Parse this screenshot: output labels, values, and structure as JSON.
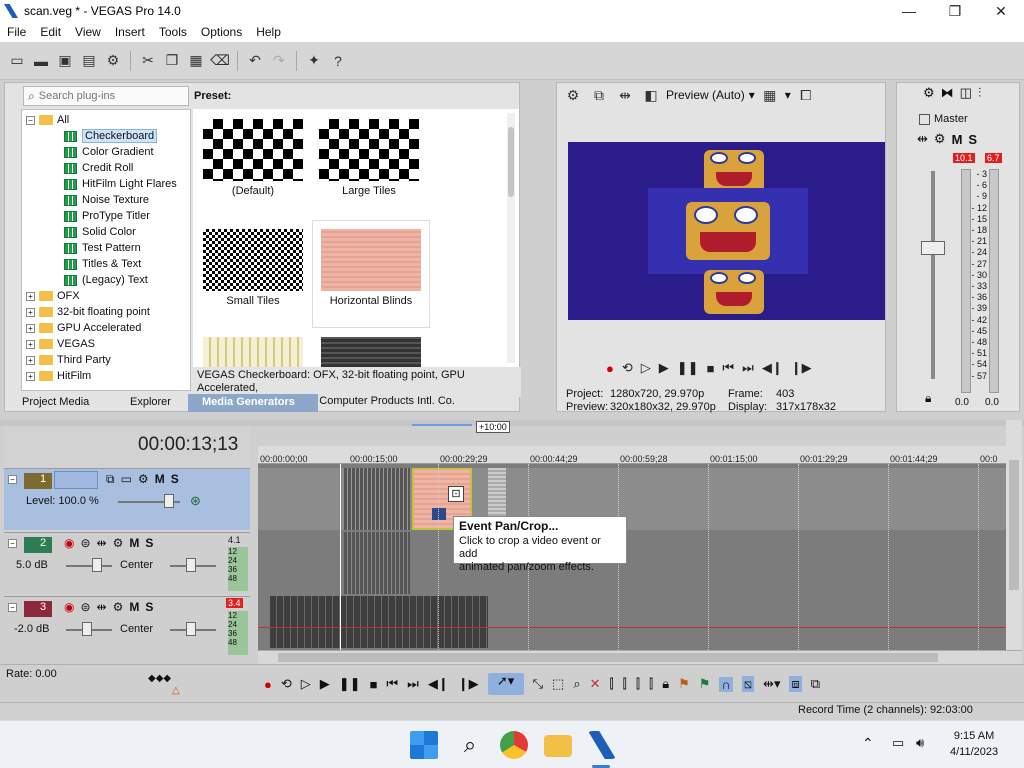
{
  "window": {
    "title": "scan.veg * - VEGAS Pro 14.0",
    "controls": [
      "—",
      "❐",
      "✕"
    ]
  },
  "menu": [
    "File",
    "Edit",
    "View",
    "Insert",
    "Tools",
    "Options",
    "Help"
  ],
  "toolbar_icons": [
    "new-icon",
    "open-icon",
    "save-icon",
    "save-as-icon",
    "properties-icon",
    "cut-icon",
    "copy-icon",
    "paste-icon",
    "delete-icon",
    "undo-icon",
    "redo-icon",
    "render-icon",
    "whats-this-icon"
  ],
  "plugins": {
    "search_placeholder": "Search plug-ins",
    "tree": {
      "root": "All",
      "children": [
        "Checkerboard",
        "Color Gradient",
        "Credit Roll",
        "HitFilm Light Flares",
        "Noise Texture",
        "ProType Titler",
        "Solid Color",
        "Test Pattern",
        "Titles & Text",
        "(Legacy) Text"
      ],
      "folders": [
        "OFX",
        "32-bit floating point",
        "GPU Accelerated",
        "VEGAS",
        "Third Party",
        "HitFilm"
      ]
    },
    "preset_label": "Preset:",
    "presets": [
      "(Default)",
      "Large Tiles",
      "Small Tiles",
      "Horizontal Blinds"
    ],
    "description_line1": "VEGAS Checkerboard: OFX, 32-bit floating point, GPU Accelerated,",
    "description_line2": "Description: From Magix Computer Products Intl. Co.",
    "tabs": [
      "Project Media",
      "Explorer",
      "Media Generators"
    ]
  },
  "preview": {
    "quality": "Preview (Auto)",
    "project_label": "Project:",
    "project_value": "1280x720, 29.970p",
    "preview_label": "Preview:",
    "preview_value": "320x180x32, 29.970p",
    "frame_label": "Frame:",
    "frame_value": "403",
    "display_label": "Display:",
    "display_value": "317x178x32"
  },
  "master": {
    "title": "Master",
    "mute": "M",
    "solo": "S",
    "peak_left": "10.1",
    "peak_right": "6.7",
    "scale": [
      "3",
      "6",
      "9",
      "12",
      "15",
      "18",
      "21",
      "24",
      "27",
      "30",
      "33",
      "36",
      "39",
      "42",
      "45",
      "48",
      "51",
      "54",
      "57"
    ],
    "level_left": "0.0",
    "level_right": "0.0"
  },
  "timeline": {
    "timecode": "00:00:13;13",
    "zoom_marker": "+10:00",
    "ruler": [
      "00:00:00;00",
      "00:00:15;00",
      "00:00:29;29",
      "00:00:44;29",
      "00:00:59;28",
      "00:01:15;00",
      "00:01:29;29",
      "00:01:44;29",
      "00:0"
    ],
    "tracks": [
      {
        "num": "1",
        "label": "Level: 100.0 %",
        "mute": "M",
        "solo": "S"
      },
      {
        "num": "2",
        "label": "5.0 dB",
        "pan": "Center",
        "mute": "M",
        "solo": "S",
        "meter": "4.1"
      },
      {
        "num": "3",
        "label": "-2.0 dB",
        "pan": "Center",
        "mute": "M",
        "solo": "S",
        "meter": "3.4"
      }
    ],
    "meter_scale": [
      "12",
      "24",
      "36",
      "48"
    ],
    "tooltip_title": "Event Pan/Crop...",
    "tooltip_body_1": "Click to crop a video event or add",
    "tooltip_body_2": "animated pan/zoom effects.",
    "rate": "Rate: 0.00",
    "record_time": "Record Time (2 channels): 92:03:00"
  },
  "taskbar": {
    "time": "9:15 AM",
    "date": "4/11/2023"
  }
}
